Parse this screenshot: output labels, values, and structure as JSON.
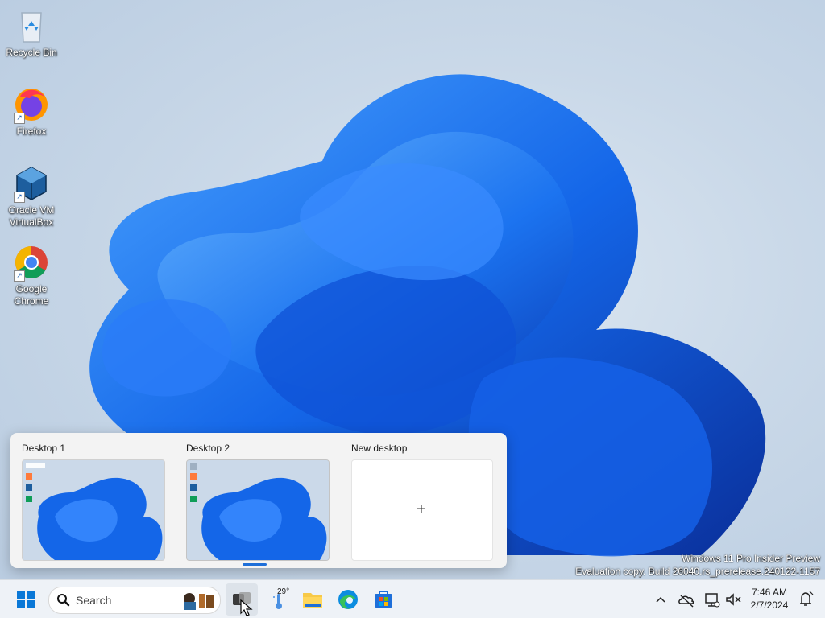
{
  "desktop": {
    "icons": [
      {
        "label": "Recycle Bin",
        "icon": "recycle-bin-icon"
      },
      {
        "label": "Firefox",
        "icon": "firefox-icon"
      },
      {
        "label": "Oracle VM VirtualBox",
        "icon": "virtualbox-icon"
      },
      {
        "label": "Google Chrome",
        "icon": "chrome-icon"
      }
    ],
    "watermark": {
      "line1": "Windows 11 Pro Insider Preview",
      "line2": "Evaluation copy. Build 26040.rs_prerelease.240122-1157"
    }
  },
  "task_view": {
    "desktops": [
      {
        "label": "Desktop 1"
      },
      {
        "label": "Desktop 2"
      }
    ],
    "new_desktop_label": "New desktop",
    "plus_symbol": "+"
  },
  "taskbar": {
    "search_placeholder": "Search",
    "weather_temp": "29°",
    "time": "7:46 AM",
    "date": "2/7/2024"
  },
  "colors": {
    "accent": "#1e6fd9",
    "wallpaper_blue": "#0a5de0"
  }
}
